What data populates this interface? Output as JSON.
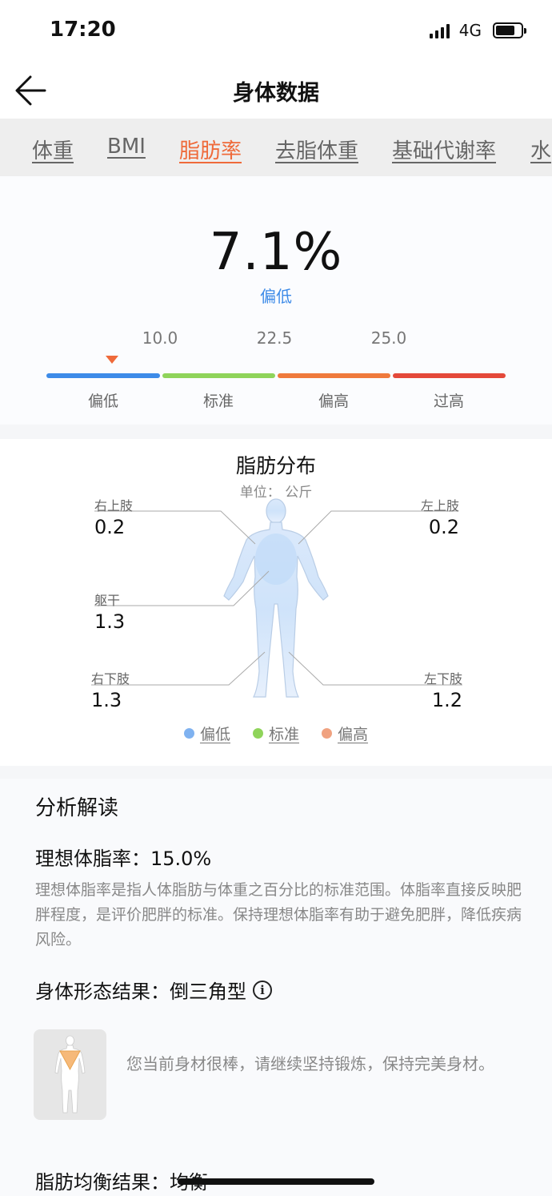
{
  "status_bar": {
    "time": "17:20",
    "network": "4G",
    "battery_level": 0.78
  },
  "nav": {
    "title": "身体数据",
    "back_icon": "arrow-left-icon"
  },
  "tabs": [
    {
      "label": "体重",
      "active": false
    },
    {
      "label": "BMI",
      "active": false
    },
    {
      "label": "脂肪率",
      "active": true
    },
    {
      "label": "去脂体重",
      "active": false
    },
    {
      "label": "基础代谢率",
      "active": false
    },
    {
      "label": "水",
      "active": false
    }
  ],
  "summary": {
    "value": "7.1%",
    "level": "偏低",
    "ticks": [
      "10.0",
      "22.5",
      "25.0"
    ],
    "segments": [
      {
        "label": "偏低",
        "color": "#3d8be8"
      },
      {
        "label": "标准",
        "color": "#8fd45a"
      },
      {
        "label": "偏高",
        "color": "#ef7a3c"
      },
      {
        "label": "过高",
        "color": "#e4493a"
      }
    ],
    "marker_color": "#ef6a3a"
  },
  "distribution": {
    "title": "脂肪分布",
    "unit": "单位： 公斤",
    "regions": {
      "right_upper": {
        "label": "右上肢",
        "value": "0.2"
      },
      "left_upper": {
        "label": "左上肢",
        "value": "0.2"
      },
      "trunk": {
        "label": "躯干",
        "value": "1.3"
      },
      "right_lower": {
        "label": "右下肢",
        "value": "1.3"
      },
      "left_lower": {
        "label": "左下肢",
        "value": "1.2"
      }
    },
    "legend": [
      {
        "label": "偏低",
        "color": "#7fb2f0"
      },
      {
        "label": "标准",
        "color": "#8fd45a"
      },
      {
        "label": "偏高",
        "color": "#f0a280"
      }
    ]
  },
  "analysis": {
    "title": "分析解读",
    "ideal_title": "理想体脂率：15.0%",
    "ideal_desc": "理想体脂率是指人体脂肪与体重之百分比的标准范围。体脂率直接反映肥胖程度，是评价肥胖的标准。保持理想体脂率有助于避免肥胖，降低疾病风险。",
    "shape_title": "身体形态结果：倒三角型",
    "shape_desc": "您当前身材很棒，请继续坚持锻炼，保持完美身材。",
    "balance_title": "脂肪均衡结果：均衡"
  }
}
